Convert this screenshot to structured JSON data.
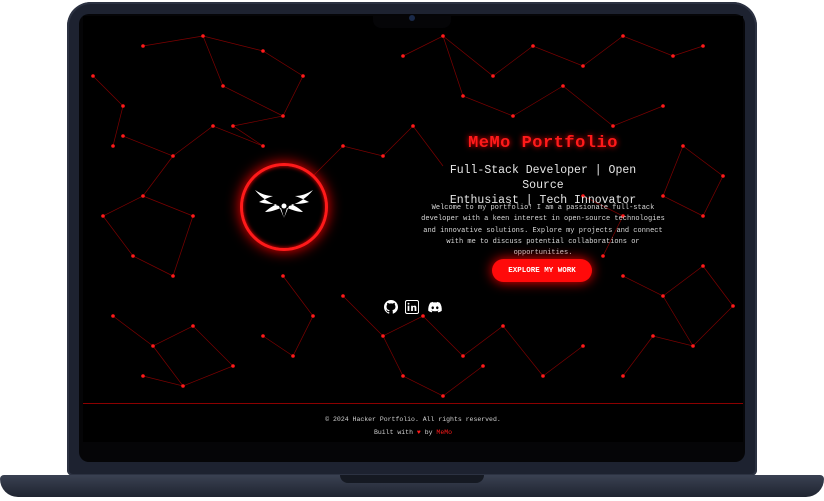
{
  "hero": {
    "title": "MeMo Portfolio",
    "subtitle_line1": "Full-Stack Developer | Open Source",
    "subtitle_line2": "Enthusiast | Tech Innovator",
    "intro_lines": [
      "Welcome to my portfolio! I am a passionate full-stack",
      "developer with a keen interest in open-source technologies",
      "and innovative solutions. Explore my projects and connect",
      "with me to discuss potential collaborations or",
      "opportunities."
    ],
    "cta_label": "EXPLORE MY WORK"
  },
  "social_icons": [
    "github-icon",
    "linkedin-icon",
    "discord-icon"
  ],
  "footer": {
    "copyright": "© 2024 Hacker Portfolio. All rights reserved.",
    "built_with": "Built with",
    "heart": "♥",
    "by": "by",
    "author": "MeMo"
  },
  "colors": {
    "accent": "#ff1a1a",
    "background": "#000000",
    "text": "#e6e6e6"
  }
}
